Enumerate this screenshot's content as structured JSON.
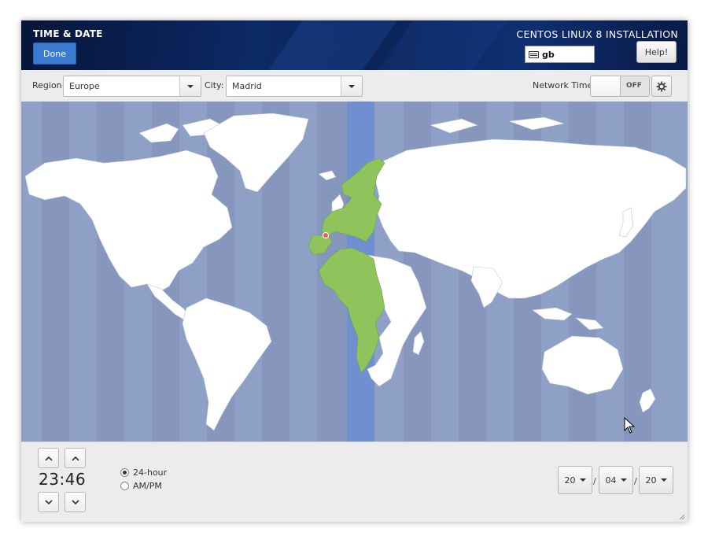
{
  "header": {
    "title": "TIME & DATE",
    "done_label": "Done",
    "product": "CENTOS LINUX 8 INSTALLATION",
    "keyboard_layout": "gb",
    "help_label": "Help!"
  },
  "toolbar": {
    "region_label": "Region:",
    "region_value": "Europe",
    "city_label": "City:",
    "city_value": "Madrid",
    "network_time_label": "Network Time",
    "network_time_state": "OFF"
  },
  "map": {
    "highlight_color": "#8fc45c",
    "ocean_color": "#8fa0c7",
    "land_color": "#ffffff",
    "selected_zone_color": "#6f8fd0"
  },
  "clock": {
    "hours": "23",
    "separator": ":",
    "minutes": "46",
    "format_24": "24-hour",
    "format_ampm": "AM/PM",
    "selected_format": "24-hour"
  },
  "date": {
    "day": "20",
    "month": "04",
    "year": "20",
    "separator": "/"
  },
  "colors": {
    "accent": "#3a7bd0",
    "header_bg": "#0c2a66"
  }
}
